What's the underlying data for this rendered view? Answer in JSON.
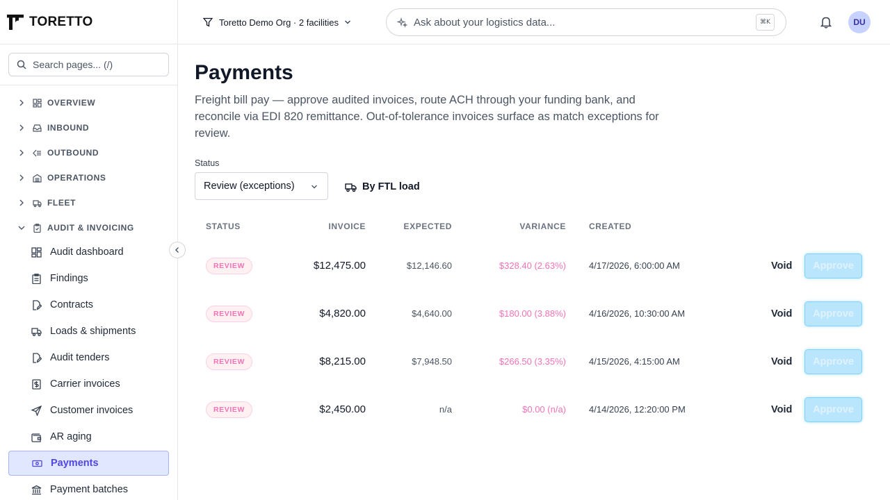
{
  "brand": {
    "name": "TORETTO"
  },
  "search": {
    "placeholder": "Search pages...  (/)"
  },
  "nav": {
    "groups": [
      {
        "label": "OVERVIEW",
        "icon": "grid-icon"
      },
      {
        "label": "INBOUND",
        "icon": "inbox-icon"
      },
      {
        "label": "OUTBOUND",
        "icon": "outbound-icon"
      },
      {
        "label": "OPERATIONS",
        "icon": "warehouse-icon"
      },
      {
        "label": "FLEET",
        "icon": "truck-icon"
      },
      {
        "label": "AUDIT & INVOICING",
        "icon": "clipboard-icon"
      }
    ],
    "items": [
      {
        "label": "Audit dashboard",
        "icon": "grid-icon"
      },
      {
        "label": "Findings",
        "icon": "clipboard-icon"
      },
      {
        "label": "Contracts",
        "icon": "file-edit-icon"
      },
      {
        "label": "Loads & shipments",
        "icon": "truck-icon"
      },
      {
        "label": "Audit tenders",
        "icon": "file-edit-icon"
      },
      {
        "label": "Carrier invoices",
        "icon": "dollar-receipt-icon"
      },
      {
        "label": "Customer invoices",
        "icon": "send-icon"
      },
      {
        "label": "AR aging",
        "icon": "wallet-icon"
      },
      {
        "label": "Payments",
        "icon": "banknote-icon",
        "active": true
      },
      {
        "label": "Payment batches",
        "icon": "bank-icon"
      }
    ]
  },
  "topbar": {
    "org": "Toretto Demo Org · 2 facilities",
    "ask_placeholder": "Ask about your logistics data...",
    "shortcut": "⌘K",
    "avatar": "DU"
  },
  "page": {
    "title": "Payments",
    "description": "Freight bill pay — approve audited invoices, route ACH through your funding bank, and reconcile via EDI 820 remittance. Out-of-tolerance invoices surface as match exceptions for review.",
    "filter_label": "Status",
    "filter_value": "Review (exceptions)",
    "ftl_button": "By FTL load"
  },
  "table": {
    "headers": {
      "status": "STATUS",
      "invoice": "INVOICE",
      "expected": "EXPECTED",
      "variance": "VARIANCE",
      "created": "CREATED"
    },
    "rows": [
      {
        "status": "REVIEW",
        "invoice": "$12,475.00",
        "expected": "$12,146.60",
        "variance": "$328.40 (2.63%)",
        "created": "4/17/2026, 6:00:00 AM",
        "void": "Void",
        "approve": "Approve"
      },
      {
        "status": "REVIEW",
        "invoice": "$4,820.00",
        "expected": "$4,640.00",
        "variance": "$180.00 (3.88%)",
        "created": "4/16/2026, 10:30:00 AM",
        "void": "Void",
        "approve": "Approve"
      },
      {
        "status": "REVIEW",
        "invoice": "$8,215.00",
        "expected": "$7,948.50",
        "variance": "$266.50 (3.35%)",
        "created": "4/15/2026, 4:15:00 AM",
        "void": "Void",
        "approve": "Approve"
      },
      {
        "status": "REVIEW",
        "invoice": "$2,450.00",
        "expected": "n/a",
        "variance": "$0.00 (n/a)",
        "created": "4/14/2026, 12:20:00 PM",
        "void": "Void",
        "approve": "Approve"
      }
    ]
  },
  "colors": {
    "accent": "#4f46e5",
    "review": "#f472b6",
    "approve_bg": "#bae6fd"
  }
}
